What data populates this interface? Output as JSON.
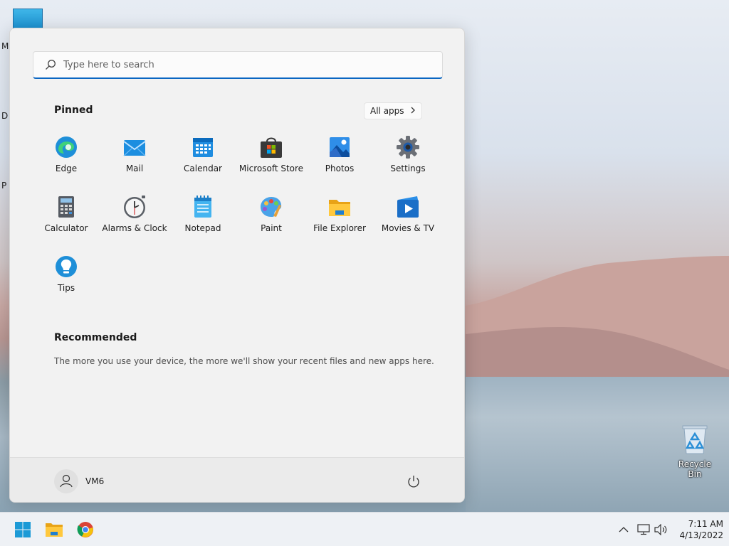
{
  "desktop": {
    "left_letters": [
      "M",
      "D",
      "P"
    ],
    "recycle_bin_label": "Recycle Bin"
  },
  "start_menu": {
    "search_placeholder": "Type here to search",
    "pinned_title": "Pinned",
    "all_apps_label": "All apps",
    "pinned_apps": [
      {
        "label": "Edge",
        "icon": "edge-icon"
      },
      {
        "label": "Mail",
        "icon": "mail-icon"
      },
      {
        "label": "Calendar",
        "icon": "calendar-icon"
      },
      {
        "label": "Microsoft Store",
        "icon": "store-icon"
      },
      {
        "label": "Photos",
        "icon": "photos-icon"
      },
      {
        "label": "Settings",
        "icon": "gear-icon"
      },
      {
        "label": "Calculator",
        "icon": "calculator-icon"
      },
      {
        "label": "Alarms & Clock",
        "icon": "clock-icon"
      },
      {
        "label": "Notepad",
        "icon": "notepad-icon"
      },
      {
        "label": "Paint",
        "icon": "paint-icon"
      },
      {
        "label": "File Explorer",
        "icon": "folder-icon"
      },
      {
        "label": "Movies & TV",
        "icon": "movies-icon"
      },
      {
        "label": "Tips",
        "icon": "tips-icon"
      }
    ],
    "recommended_title": "Recommended",
    "recommended_text": "The more you use your device, the more we'll show your recent files and new apps here.",
    "user_name": "VM6"
  },
  "taskbar": {
    "time": "7:11 AM",
    "date": "4/13/2022"
  },
  "colors": {
    "accent": "#0a66c2",
    "menu_bg": "#f2f2f2"
  }
}
